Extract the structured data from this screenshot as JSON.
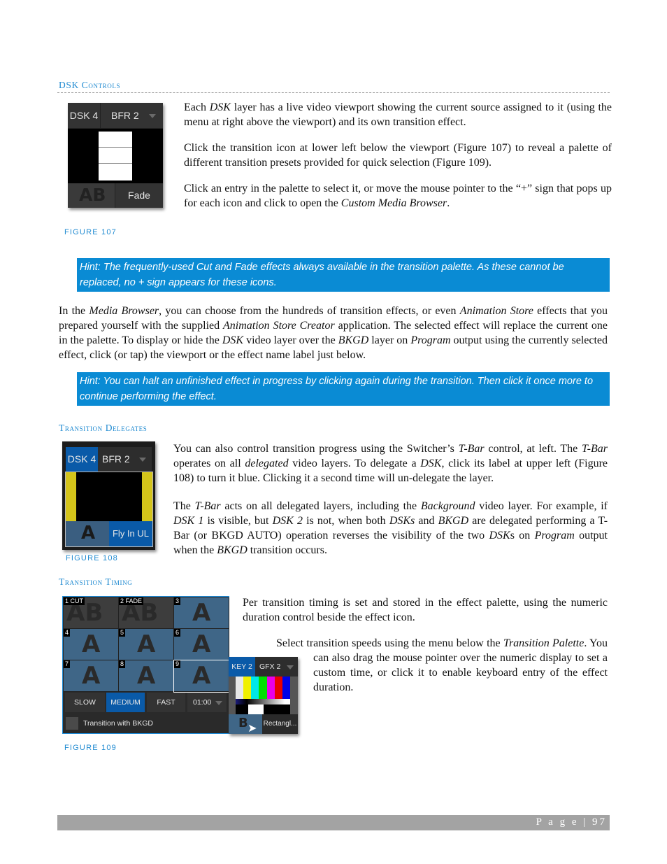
{
  "sections": {
    "dsk_controls": {
      "heading": "DSK Controls",
      "paragraphs": [
        [
          "Each ",
          {
            "i": "DSK"
          },
          " layer has a live video viewport showing the current source assigned to it (using the menu at right above the viewport) and its own transition effect."
        ],
        [
          "Click the transition icon at lower left below the viewport (Figure 107) to reveal a palette of different transition presets provided for quick selection (Figure 109)."
        ],
        [
          "Click an entry in the palette to select it, or move the mouse pointer to the “+” sign that pops up for each icon and click to open the ",
          {
            "i": "Custom Media Browser"
          },
          "."
        ]
      ],
      "figure_caption": "FIGURE 107",
      "hint1": "Hint: The frequently-used Cut and Fade effects always available in the transition palette. As these cannot be replaced, no + sign appears for these icons.",
      "body": [
        "In the ",
        {
          "i": "Media Browser"
        },
        ", you can choose from the hundreds of transition effects, or even ",
        {
          "i": "Animation Store"
        },
        " effects that you prepared yourself with the supplied ",
        {
          "i": "Animation Store Creator"
        },
        " application.  The selected effect will replace the current one in the palette.  To display or hide the ",
        {
          "i": "DSK"
        },
        " video layer over the ",
        {
          "i": "BKGD"
        },
        " layer on ",
        {
          "i": "Program"
        },
        " output using the currently selected effect, click (or tap) the viewport or the effect name label just below."
      ],
      "hint2": "Hint: You can halt an unfinished effect in progress by clicking again during the transition. Then click it once more to continue performing the effect."
    },
    "transition_delegates": {
      "heading": "Transition Delegates",
      "paragraphs": [
        [
          "You can also control transition progress using the Switcher’s ",
          {
            "i": "T-Bar"
          },
          " control, at left.  The ",
          {
            "i": "T-Bar"
          },
          " operates on all ",
          {
            "i": "delegated"
          },
          " video layers.  To delegate a ",
          {
            "i": "DSK"
          },
          ", click its label at upper left (Figure 108) to turn it blue.  Clicking it a second time will un-delegate the layer."
        ],
        [
          "The ",
          {
            "i": "T-Bar"
          },
          " acts on all delegated layers, including the ",
          {
            "i": "Background"
          },
          " video layer.  For example, if ",
          {
            "i": "DSK 1"
          },
          " is visible, but ",
          {
            "i": "DSK 2"
          },
          " is not, when both ",
          {
            "i": "DSKs"
          },
          " and ",
          {
            "i": "BKGD"
          },
          " are delegated performing a T-Bar (or BKGD AUTO) operation reverses the visibility of the two ",
          {
            "i": "DSK"
          },
          "s on ",
          {
            "i": "Program"
          },
          " output when the ",
          {
            "i": "BKGD"
          },
          " transition occurs."
        ]
      ],
      "figure_caption": "FIGURE 108"
    },
    "transition_timing": {
      "heading": "Transition Timing",
      "paragraphs": [
        [
          "Per transition timing is set and stored in the effect palette, using the numeric duration control beside the effect icon."
        ],
        [
          "Select transition speeds using the menu below the ",
          {
            "i": "Transition Palette"
          },
          ".  You can also drag the mouse pointer over the numeric display to set a custom time, or click it to enable keyboard entry of the effect duration."
        ]
      ],
      "figure_caption": "FIGURE 109"
    }
  },
  "fig107": {
    "dsk_label": "DSK 4",
    "source_label": "BFR 2",
    "effect_label": "Fade",
    "transition_icon": "ab-transition-icon"
  },
  "fig108": {
    "dsk_label": "DSK 4",
    "source_label": "BFR 2",
    "effect_label": "Fly In UL",
    "transition_icon": "fly-in-transition-icon"
  },
  "fig109": {
    "palette": [
      {
        "num": "1 CUT"
      },
      {
        "num": "2 FADE"
      },
      {
        "num": "3"
      },
      {
        "num": "4"
      },
      {
        "num": "5"
      },
      {
        "num": "6"
      },
      {
        "num": "7"
      },
      {
        "num": "8"
      },
      {
        "num": "9"
      }
    ],
    "speeds": [
      "SLOW",
      "MEDIUM",
      "FAST"
    ],
    "selected_speed": "MEDIUM",
    "duration": "01:00",
    "checkbox_label": "Transition with BKGD",
    "checkbox_checked": false,
    "key_label": "KEY 2",
    "key_source": "GFX 2",
    "key_effect": "Rectangl...",
    "colors": {
      "accent": "#0a5aa8",
      "palette_bg": "#3f6687",
      "frame": "#1d8ad6"
    }
  },
  "footer": {
    "page_label": "P a g e",
    "page_number": "97"
  },
  "colors": {
    "heading": "#1f8ad1",
    "hint_bg": "#0a8bd4",
    "footer_bg": "#a3a3a3"
  }
}
